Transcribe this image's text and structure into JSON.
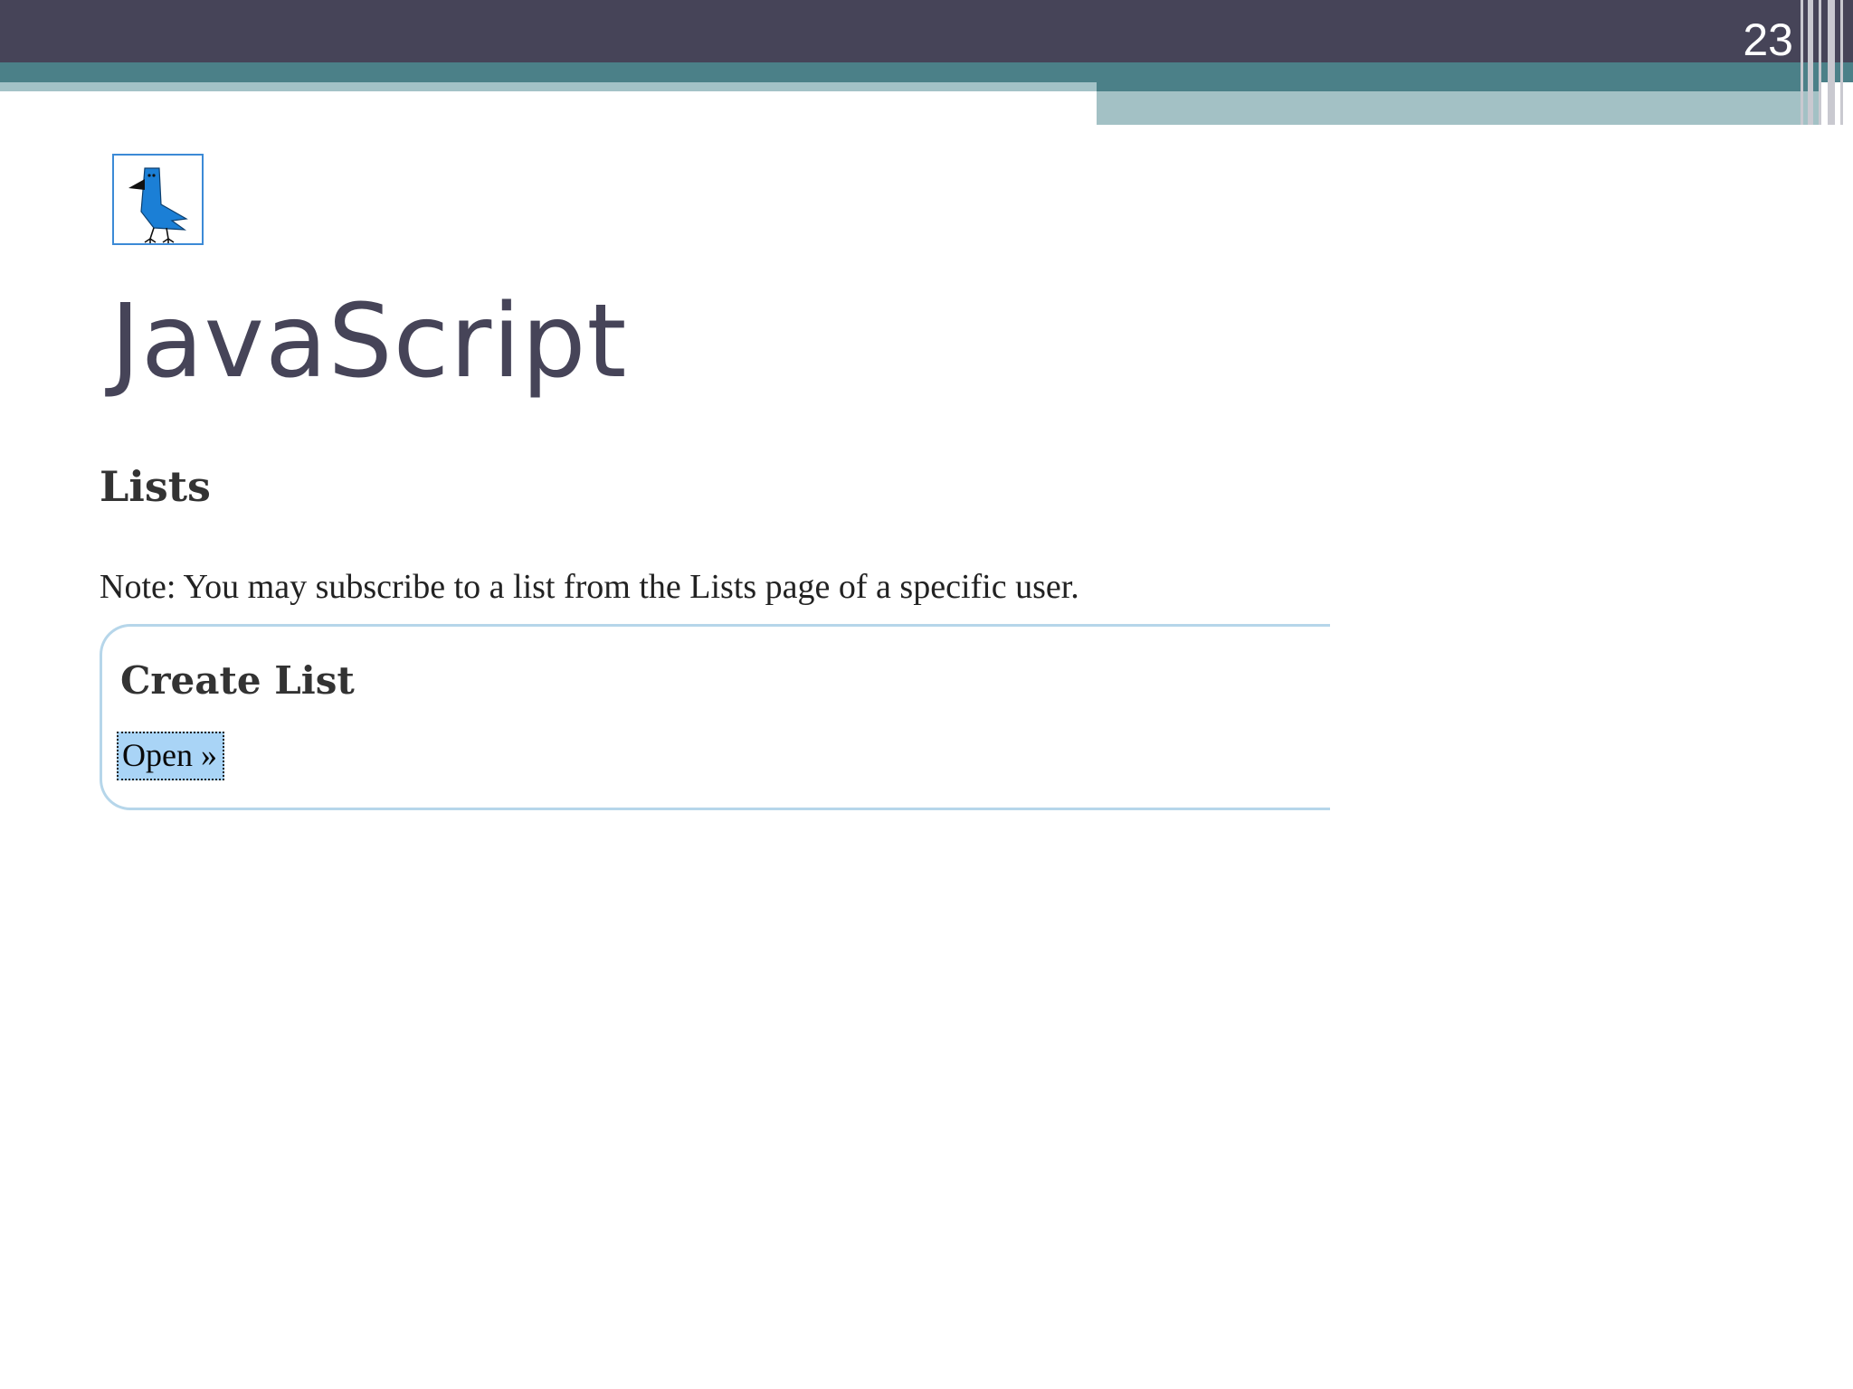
{
  "slide": {
    "number": "23",
    "title": "JavaScript",
    "colors": {
      "header_dark": "#464458",
      "header_teal": "#4b8088",
      "header_light": "#a3c2c7",
      "title_text": "#464458"
    }
  },
  "logo": {
    "icon": "blue-bird-icon"
  },
  "page": {
    "heading": "Lists",
    "note": "Note: You may subscribe to a list from the Lists page of a specific user.",
    "panel": {
      "heading": "Create List",
      "open_link": "Open »"
    },
    "colors": {
      "panel_border": "#b6d6ea",
      "link_highlight": "#a9d4f6"
    }
  }
}
